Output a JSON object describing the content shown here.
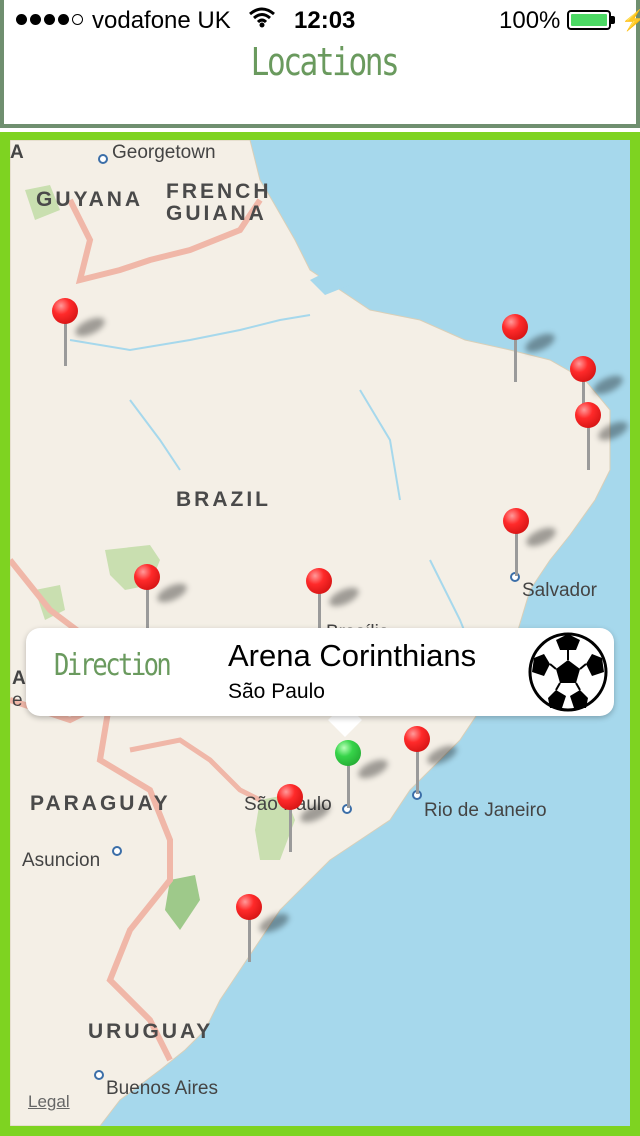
{
  "status_bar": {
    "carrier": "vodafone UK",
    "time": "12:03",
    "battery_percent": "100%",
    "signal_bars_filled": 4,
    "signal_bars_total": 5
  },
  "header": {
    "title": "Locations"
  },
  "map": {
    "country_labels": [
      "GUYANA",
      "FRENCH\nGUIANA",
      "BRAZIL",
      "PARAGUAY",
      "URUGUAY"
    ],
    "labels": {
      "guyana": "GUYANA",
      "french_guiana_1": "FRENCH",
      "french_guiana_2": "GUIANA",
      "brazil": "BRAZIL",
      "paraguay": "PARAGUAY",
      "uruguay": "URUGUAY"
    },
    "cities": {
      "georgetown": "Georgetown",
      "salvador": "Salvador",
      "brasilia": "Brasília",
      "sao_paulo": "São Paulo",
      "rio": "Rio de Janeiro",
      "asuncion": "Asuncion",
      "buenos_aires": "Buenos Aires"
    },
    "legal": "Legal",
    "edge_letters": {
      "top": "A",
      "side": "A",
      "side2": "e"
    }
  },
  "callout": {
    "action_label": "Direction",
    "title": "Arena Corinthians",
    "subtitle": "São Paulo",
    "icon": "soccer-ball-icon"
  },
  "colors": {
    "accent_green": "#6a9a5e",
    "frame_green": "#7ed321",
    "pin_red": "#ff2a2a",
    "pin_selected": "#37d44a",
    "water": "#a6d8ec",
    "land": "#f4efe6"
  }
}
